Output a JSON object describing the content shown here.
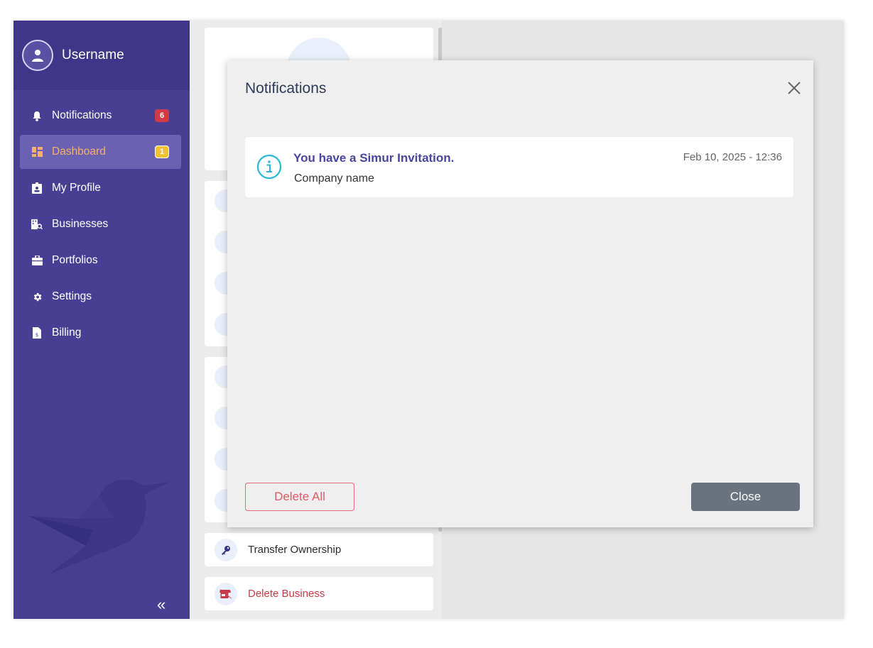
{
  "user": {
    "name": "Username"
  },
  "sidebar": {
    "items": [
      {
        "label": "Notifications",
        "icon": "bell-icon",
        "badge": "6",
        "badge_color": "#d13b45"
      },
      {
        "label": "Dashboard",
        "icon": "dashboard-icon",
        "badge": "1",
        "badge_color": "#f2c230",
        "active": true
      },
      {
        "label": "My Profile",
        "icon": "id-badge-icon"
      },
      {
        "label": "Businesses",
        "icon": "building-search-icon"
      },
      {
        "label": "Portfolios",
        "icon": "briefcase-icon"
      },
      {
        "label": "Settings",
        "icon": "gear-icon"
      },
      {
        "label": "Billing",
        "icon": "invoice-icon"
      }
    ],
    "collapse_icon": "double-chevron-left-icon"
  },
  "actions": {
    "transfer_ownership": "Transfer Ownership",
    "delete_business": "Delete Business"
  },
  "modal": {
    "title": "Notifications",
    "notifications": [
      {
        "title": "You have a Simur Invitation.",
        "subtitle": "Company name",
        "date": "Feb 10, 2025 - 12:36",
        "icon": "info-icon"
      }
    ],
    "delete_all_label": "Delete All",
    "close_label": "Close"
  },
  "colors": {
    "sidebar_bg": "#483f94",
    "accent_active": "#f4b06b",
    "danger": "#c83a46",
    "info": "#2bb7d8"
  }
}
